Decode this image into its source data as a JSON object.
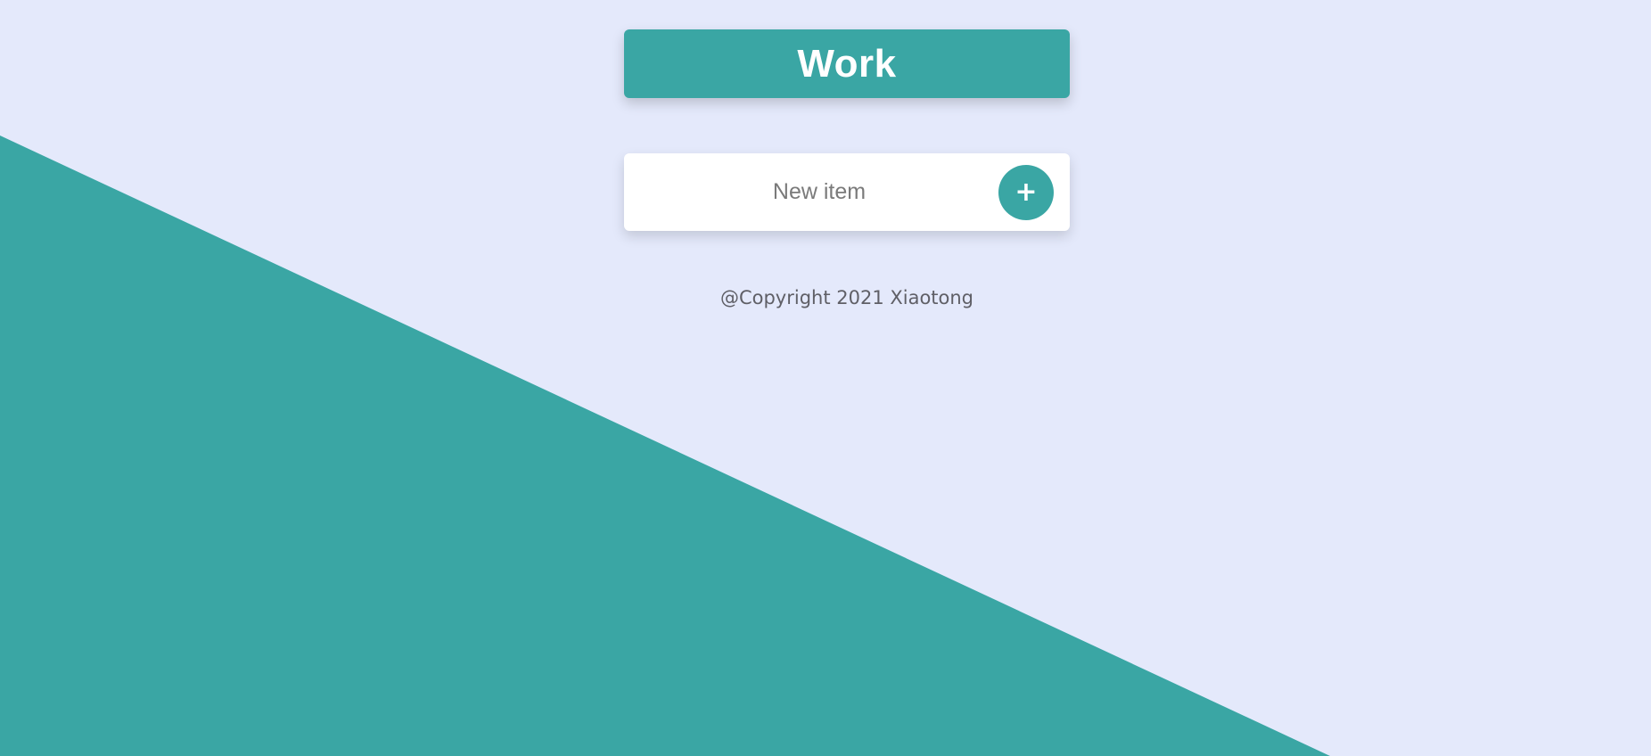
{
  "header": {
    "title": "Work"
  },
  "new_item_form": {
    "placeholder": "New item",
    "add_button_label": "+"
  },
  "footer": {
    "copyright": "@Copyright 2021 Xiaotong"
  },
  "colors": {
    "background": "#e4e9fb",
    "accent": "#3aa6a4",
    "card": "#ffffff"
  }
}
